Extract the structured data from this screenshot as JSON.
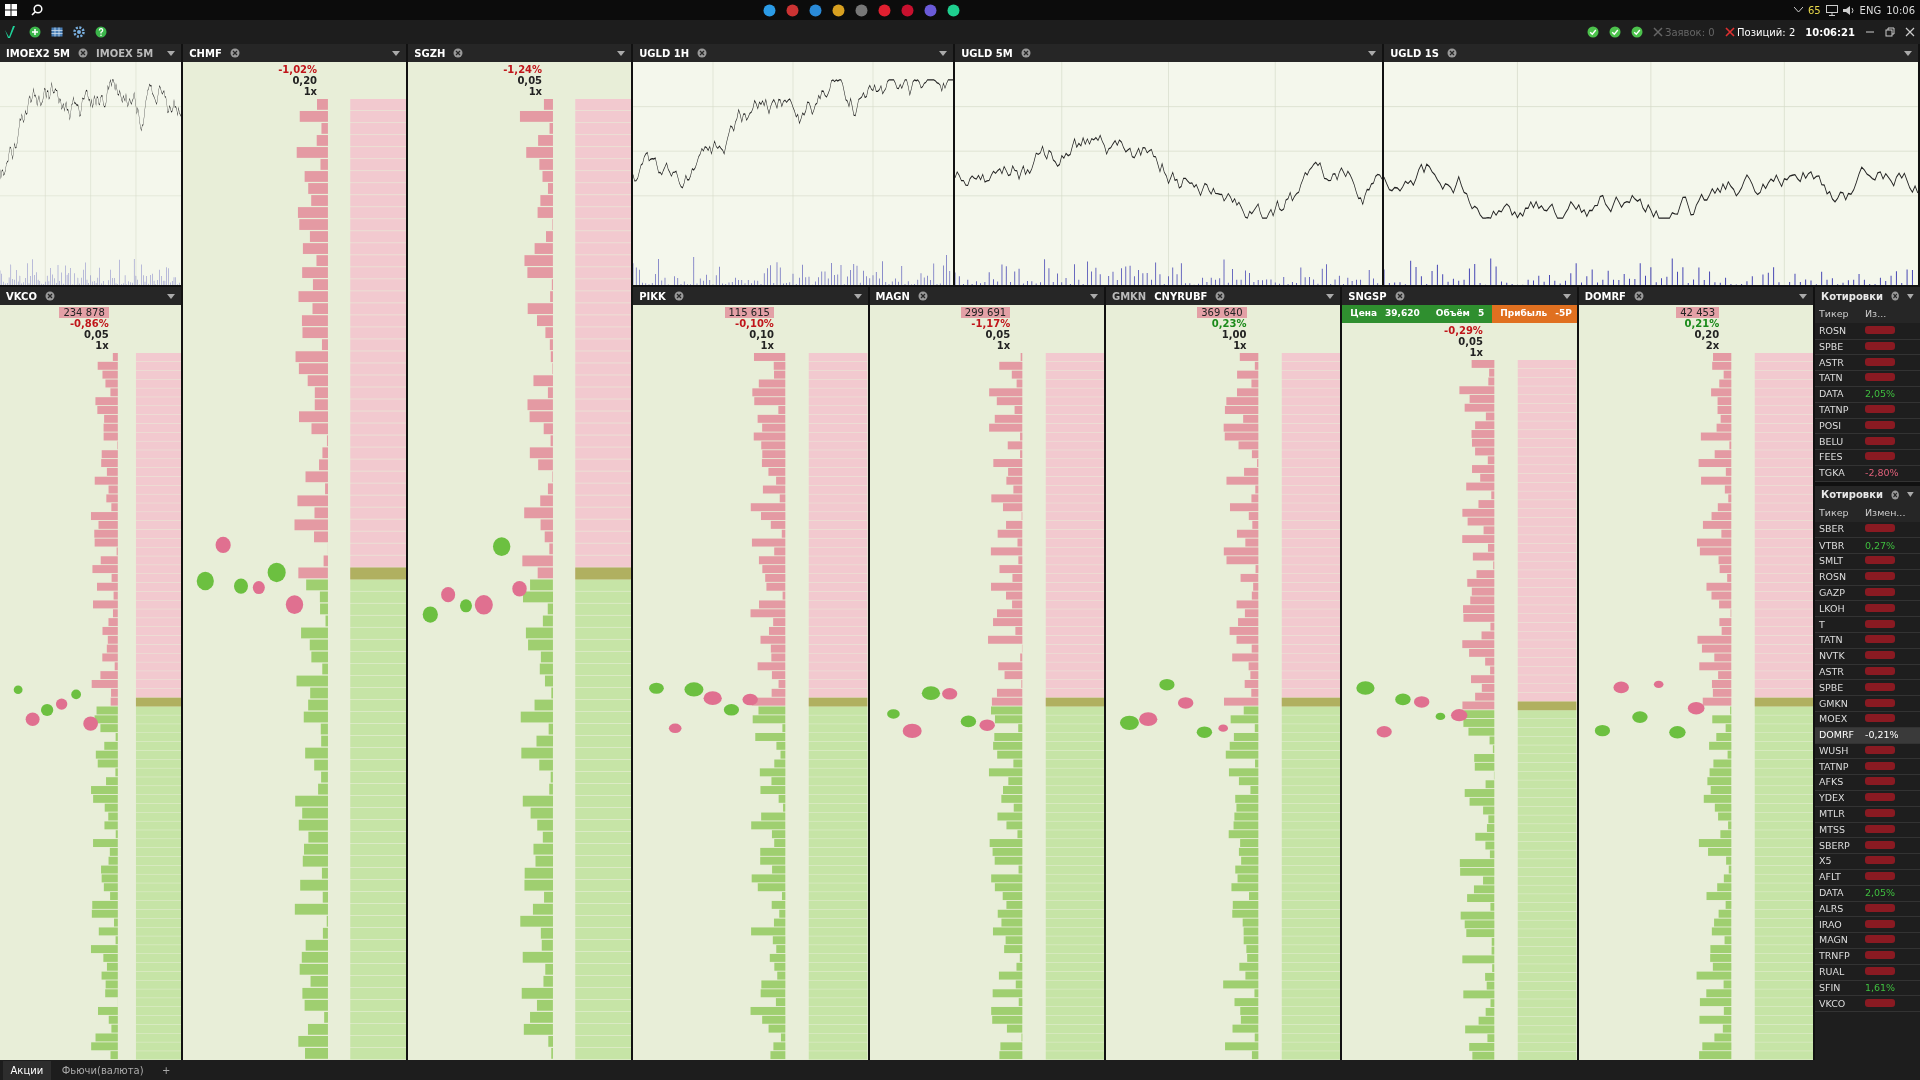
{
  "taskbar": {
    "badge": "65",
    "lang": "ENG",
    "time": "10:06"
  },
  "toolbar": {
    "orders": "Заявок: 0",
    "positions": "Позиций: 2",
    "clock": "10:06:21"
  },
  "top_charts": [
    {
      "tabs": [
        {
          "label": "IMOEX2 5M",
          "selected": true
        },
        {
          "label": "IMOEX 5M",
          "selected": false
        }
      ]
    },
    {
      "tabs": [
        {
          "label": "UGLD 1H",
          "selected": true
        }
      ]
    },
    {
      "tabs": [
        {
          "label": "UGLD 5M",
          "selected": true
        }
      ]
    },
    {
      "tabs": [
        {
          "label": "UGLD 1S",
          "selected": true
        }
      ]
    }
  ],
  "ladders": [
    {
      "tabs": [
        {
          "label": "VKCO",
          "selected": true
        }
      ],
      "volume": "234 878",
      "change": "-0,86%",
      "step": "0,05",
      "mult": "1x"
    },
    {
      "tabs": [
        {
          "label": "CHMF",
          "selected": true
        }
      ],
      "change": "-1,02%",
      "step": "0,20",
      "mult": "1x"
    },
    {
      "tabs": [
        {
          "label": "SGZH",
          "selected": true
        }
      ],
      "change": "-1,24%",
      "step": "0,05",
      "mult": "1x"
    },
    {
      "tabs": [
        {
          "label": "PIKK",
          "selected": true
        }
      ],
      "volume": "115 615",
      "change": "-0,10%",
      "step": "0,10",
      "mult": "1x"
    },
    {
      "tabs": [
        {
          "label": "MAGN",
          "selected": true
        }
      ],
      "volume": "299 691",
      "change": "-1,17%",
      "step": "0,05",
      "mult": "1x"
    },
    {
      "tabs": [
        {
          "label": "GMKN",
          "selected": false
        },
        {
          "label": "CNYRUBF",
          "selected": true
        }
      ],
      "volume": "369 640",
      "change": "0,23%",
      "step": "1,00",
      "mult": "1x"
    },
    {
      "tabs": [
        {
          "label": "SNGSP",
          "selected": true
        }
      ],
      "order": {
        "price_label": "Цена",
        "price": "39,620",
        "volume_label": "Объём",
        "volume": "5",
        "profit_label": "Прибыль",
        "profit": "-5Р"
      },
      "change": "-0,29%",
      "step": "0,05",
      "mult": "1x"
    },
    {
      "tabs": [
        {
          "label": "DOMRF",
          "selected": true
        }
      ],
      "volume": "42 453",
      "change": "0,21%",
      "step": "0,20",
      "mult": "2x"
    }
  ],
  "quotes": [
    {
      "title": "Котировки",
      "columns": [
        "Тикер",
        "Из..."
      ],
      "rows": [
        {
          "ticker": "ROSN",
          "up": false,
          "selected": false
        },
        {
          "ticker": "SPBE",
          "up": false,
          "selected": false
        },
        {
          "ticker": "ASTR",
          "up": false,
          "selected": false
        },
        {
          "ticker": "TATN",
          "up": false,
          "selected": false
        },
        {
          "ticker": "DATA",
          "up": true,
          "change": "2,05%",
          "selected": false
        },
        {
          "ticker": "TATNP",
          "up": false,
          "selected": false
        },
        {
          "ticker": "POSI",
          "up": false,
          "selected": false
        },
        {
          "ticker": "BELU",
          "up": false,
          "selected": false
        },
        {
          "ticker": "FEES",
          "up": false,
          "selected": false
        },
        {
          "ticker": "TGKA",
          "up": false,
          "change": "-2,80%",
          "selected": false
        }
      ]
    },
    {
      "title": "Котировки",
      "columns": [
        "Тикер",
        "Измен..."
      ],
      "rows": [
        {
          "ticker": "SBER",
          "up": false,
          "selected": false
        },
        {
          "ticker": "VTBR",
          "up": true,
          "change": "0,27%",
          "selected": false
        },
        {
          "ticker": "SMLT",
          "up": false,
          "selected": false
        },
        {
          "ticker": "ROSN",
          "up": false,
          "selected": false
        },
        {
          "ticker": "GAZP",
          "up": false,
          "selected": false
        },
        {
          "ticker": "LKOH",
          "up": false,
          "selected": false
        },
        {
          "ticker": "T",
          "up": false,
          "selected": false
        },
        {
          "ticker": "TATN",
          "up": false,
          "selected": false
        },
        {
          "ticker": "NVTK",
          "up": false,
          "selected": false
        },
        {
          "ticker": "ASTR",
          "up": false,
          "selected": false
        },
        {
          "ticker": "SPBE",
          "up": false,
          "selected": false
        },
        {
          "ticker": "GMKN",
          "up": false,
          "selected": false
        },
        {
          "ticker": "MOEX",
          "up": false,
          "selected": false
        },
        {
          "ticker": "DOMRF",
          "up": false,
          "change": "-0,21%",
          "selected": true
        },
        {
          "ticker": "WUSH",
          "up": false,
          "selected": false
        },
        {
          "ticker": "TATNP",
          "up": false,
          "selected": false
        },
        {
          "ticker": "AFKS",
          "up": false,
          "selected": false
        },
        {
          "ticker": "YDEX",
          "up": false,
          "selected": false
        },
        {
          "ticker": "MTLR",
          "up": false,
          "selected": false
        },
        {
          "ticker": "MTSS",
          "up": false,
          "selected": false
        },
        {
          "ticker": "SBERP",
          "up": false,
          "selected": false
        },
        {
          "ticker": "X5",
          "up": false,
          "selected": false
        },
        {
          "ticker": "AFLT",
          "up": false,
          "selected": false
        },
        {
          "ticker": "DATA",
          "up": true,
          "change": "2,05%",
          "selected": false
        },
        {
          "ticker": "ALRS",
          "up": false,
          "selected": false
        },
        {
          "ticker": "IRAO",
          "up": false,
          "selected": false
        },
        {
          "ticker": "MAGN",
          "up": false,
          "selected": false
        },
        {
          "ticker": "TRNFP",
          "up": false,
          "selected": false
        },
        {
          "ticker": "RUAL",
          "up": false,
          "selected": false
        },
        {
          "ticker": "SFIN",
          "up": true,
          "change": "1,61%",
          "selected": false
        },
        {
          "ticker": "VKCO",
          "up": false,
          "selected": false
        }
      ]
    }
  ],
  "bottom_tabs": [
    {
      "label": "Акции",
      "selected": true
    },
    {
      "label": "Фьючи(валюта)",
      "selected": false
    }
  ],
  "add_tab": "+"
}
